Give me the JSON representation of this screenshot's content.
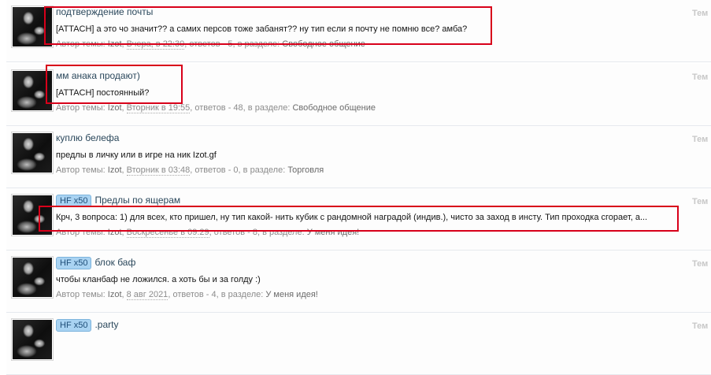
{
  "threads": [
    {
      "prefix": "",
      "title": "подтверждение почты",
      "snippet": "[ATTACH] а это чо значит?? а самих персов тоже забанят?? ну тип если я почту не помню все? амба?",
      "meta_author_label": "Автор темы:",
      "author": "Izot",
      "date": "Вчера, в 22:30",
      "replies_text": "ответов - 5",
      "forum_label": "в разделе:",
      "forum": "Свободное общение",
      "right_label": "Тем"
    },
    {
      "prefix": "",
      "title": "мм анака продают)",
      "snippet": "[ATTACH] постоянный?",
      "meta_author_label": "Автор темы:",
      "author": "Izot",
      "date": "Вторник в 19:55",
      "replies_text": "ответов - 48",
      "forum_label": "в разделе:",
      "forum": "Свободное общение",
      "right_label": "Тем"
    },
    {
      "prefix": "",
      "title": "куплю белефа",
      "snippet": "предлы в личку или в игре на ник Izot.gf",
      "meta_author_label": "Автор темы:",
      "author": "Izot",
      "date": "Вторник в 03:48",
      "replies_text": "ответов - 0",
      "forum_label": "в разделе:",
      "forum": "Торговля",
      "right_label": "Тем"
    },
    {
      "prefix": "HF x50",
      "title": "Предлы по ящерам",
      "snippet": "Крч, 3 вопроса: 1) для всех, кто пришел, ну тип какой- нить кубик с рандомной наградой (индив.), чисто за заход в инсту. Тип проходка сгорает, а...",
      "meta_author_label": "Автор темы:",
      "author": "Izot",
      "date": "Воскресенье в 09:29",
      "replies_text": "ответов - 8",
      "forum_label": "в разделе:",
      "forum": "У меня идея!",
      "right_label": "Тем"
    },
    {
      "prefix": "HF x50",
      "title": "блок баф",
      "snippet": "чтобы кланбаф не ложился. а хоть бы и за голду :)",
      "meta_author_label": "Автор темы:",
      "author": "Izot",
      "date": "8 авг 2021",
      "replies_text": "ответов - 4",
      "forum_label": "в разделе:",
      "forum": "У меня идея!",
      "right_label": "Тем"
    },
    {
      "prefix": "HF x50",
      "title": ".party",
      "snippet": "",
      "meta_author_label": "",
      "author": "",
      "date": "",
      "replies_text": "",
      "forum_label": "",
      "forum": "",
      "right_label": "Тем"
    }
  ],
  "highlight_color": "#d8001a",
  "prefix_color": "#a9d3f2"
}
